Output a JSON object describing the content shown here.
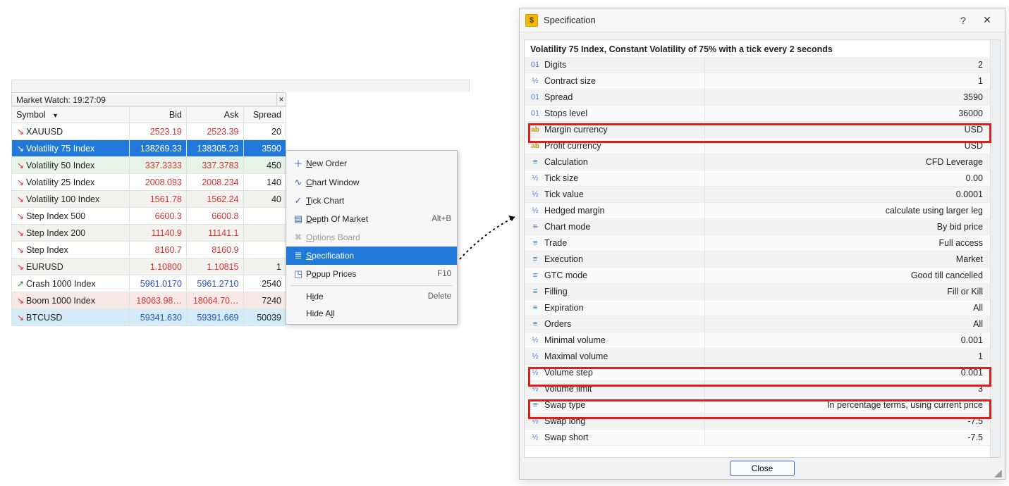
{
  "market_watch": {
    "title": "Market Watch: 19:27:09",
    "headers": {
      "symbol": "Symbol",
      "bid": "Bid",
      "ask": "Ask",
      "spread": "Spread"
    },
    "rows": [
      {
        "symbol": "XAUUSD",
        "bid": "2523.19",
        "ask": "2523.39",
        "spread": "20",
        "dir": "down",
        "selected": false,
        "rowStyle": "",
        "priceClass": "red"
      },
      {
        "symbol": "Volatility 75 Index",
        "bid": "138269.33",
        "ask": "138305.23",
        "spread": "3590",
        "dir": "down",
        "selected": true,
        "rowStyle": "",
        "priceClass": ""
      },
      {
        "symbol": "Volatility 50 Index",
        "bid": "337.3333",
        "ask": "337.3783",
        "spread": "450",
        "dir": "down",
        "selected": false,
        "rowStyle": "alt-green",
        "priceClass": "red"
      },
      {
        "symbol": "Volatility 25 Index",
        "bid": "2008.093",
        "ask": "2008.234",
        "spread": "140",
        "dir": "down",
        "selected": false,
        "rowStyle": "",
        "priceClass": "red"
      },
      {
        "symbol": "Volatility 100 Index",
        "bid": "1561.78",
        "ask": "1562.24",
        "spread": "40",
        "dir": "down",
        "selected": false,
        "rowStyle": "alt",
        "priceClass": "red"
      },
      {
        "symbol": "Step Index 500",
        "bid": "6600.3",
        "ask": "6600.8",
        "spread": "",
        "dir": "down",
        "selected": false,
        "rowStyle": "",
        "priceClass": "red"
      },
      {
        "symbol": "Step Index 200",
        "bid": "11140.9",
        "ask": "11141.1",
        "spread": "",
        "dir": "down",
        "selected": false,
        "rowStyle": "alt",
        "priceClass": "red"
      },
      {
        "symbol": "Step Index",
        "bid": "8160.7",
        "ask": "8160.9",
        "spread": "",
        "dir": "down",
        "selected": false,
        "rowStyle": "",
        "priceClass": "red"
      },
      {
        "symbol": "EURUSD",
        "bid": "1.10800",
        "ask": "1.10815",
        "spread": "1",
        "dir": "down",
        "selected": false,
        "rowStyle": "alt",
        "priceClass": "red"
      },
      {
        "symbol": "Crash 1000 Index",
        "bid": "5961.0170",
        "ask": "5961.2710",
        "spread": "2540",
        "dir": "up",
        "selected": false,
        "rowStyle": "",
        "priceClass": "blue"
      },
      {
        "symbol": "Boom 1000 Index",
        "bid": "18063.98…",
        "ask": "18064.70…",
        "spread": "7240",
        "dir": "down",
        "selected": false,
        "rowStyle": "alt-pink",
        "priceClass": "red"
      },
      {
        "symbol": "BTCUSD",
        "bid": "59341.630",
        "ask": "59391.669",
        "spread": "50039",
        "dir": "down",
        "selected": false,
        "rowStyle": "alt-blue",
        "priceClass": "blue"
      }
    ]
  },
  "context_menu": {
    "items": [
      {
        "icon": "＋",
        "label_pre": "",
        "label_u": "N",
        "label_post": "ew Order",
        "shortcut": "",
        "state": ""
      },
      {
        "icon": "∿",
        "label_pre": "",
        "label_u": "C",
        "label_post": "hart Window",
        "shortcut": "",
        "state": ""
      },
      {
        "icon": "✓",
        "label_pre": "",
        "label_u": "T",
        "label_post": "ick Chart",
        "shortcut": "",
        "state": ""
      },
      {
        "icon": "▤",
        "label_pre": "",
        "label_u": "D",
        "label_post": "epth Of Market",
        "shortcut": "Alt+B",
        "state": ""
      },
      {
        "icon": "✖",
        "label_pre": "",
        "label_u": "O",
        "label_post": "ptions Board",
        "shortcut": "",
        "state": "disabled"
      },
      {
        "icon": "≣",
        "label_pre": "",
        "label_u": "S",
        "label_post": "pecification",
        "shortcut": "",
        "state": "sel"
      },
      {
        "icon": "◳",
        "label_pre": "P",
        "label_u": "o",
        "label_post": "pup Prices",
        "shortcut": "F10",
        "state": ""
      },
      {
        "sep": true
      },
      {
        "icon": "",
        "label_pre": "H",
        "label_u": "i",
        "label_post": "de",
        "shortcut": "Delete",
        "state": ""
      },
      {
        "icon": "",
        "label_pre": "Hide A",
        "label_u": "l",
        "label_post": "l",
        "shortcut": "",
        "state": ""
      }
    ]
  },
  "spec": {
    "title": "Specification",
    "header": "Volatility 75 Index, Constant Volatility of 75% with a tick every 2 seconds",
    "close_btn": "Close",
    "rows": [
      {
        "ico": "01",
        "icoClass": "",
        "key": "Digits",
        "val": "2"
      },
      {
        "ico": "½",
        "icoClass": "half",
        "key": "Contract size",
        "val": "1"
      },
      {
        "ico": "01",
        "icoClass": "",
        "key": "Spread",
        "val": "3590"
      },
      {
        "ico": "01",
        "icoClass": "",
        "key": "Stops level",
        "val": "36000"
      },
      {
        "ico": "ab",
        "icoClass": "ab",
        "key": "Margin currency",
        "val": "USD"
      },
      {
        "ico": "ab",
        "icoClass": "ab",
        "key": "Profit currency",
        "val": "USD"
      },
      {
        "ico": "≡",
        "icoClass": "lines",
        "key": "Calculation",
        "val": "CFD Leverage"
      },
      {
        "ico": "½",
        "icoClass": "half",
        "key": "Tick size",
        "val": "0.00"
      },
      {
        "ico": "½",
        "icoClass": "half",
        "key": "Tick value",
        "val": "0.0001"
      },
      {
        "ico": "½",
        "icoClass": "half",
        "key": "Hedged margin",
        "val": "calculate using larger leg"
      },
      {
        "ico": "≡",
        "icoClass": "lines",
        "key": "Chart mode",
        "val": "By bid price"
      },
      {
        "ico": "≡",
        "icoClass": "lines",
        "key": "Trade",
        "val": "Full access"
      },
      {
        "ico": "≡",
        "icoClass": "lines",
        "key": "Execution",
        "val": "Market"
      },
      {
        "ico": "≡",
        "icoClass": "lines",
        "key": "GTC mode",
        "val": "Good till cancelled"
      },
      {
        "ico": "≡",
        "icoClass": "lines",
        "key": "Filling",
        "val": "Fill or Kill"
      },
      {
        "ico": "≡",
        "icoClass": "lines",
        "key": "Expiration",
        "val": "All"
      },
      {
        "ico": "≡",
        "icoClass": "lines",
        "key": "Orders",
        "val": "All"
      },
      {
        "ico": "½",
        "icoClass": "half",
        "key": "Minimal volume",
        "val": "0.001"
      },
      {
        "ico": "½",
        "icoClass": "half",
        "key": "Maximal volume",
        "val": "1"
      },
      {
        "ico": "½",
        "icoClass": "half",
        "key": "Volume step",
        "val": "0.001"
      },
      {
        "ico": "½",
        "icoClass": "half",
        "key": "Volume limit",
        "val": "3"
      },
      {
        "ico": "≡",
        "icoClass": "lines",
        "key": "Swap type",
        "val": "In percentage terms, using current price"
      },
      {
        "ico": "½",
        "icoClass": "half",
        "key": "Swap long",
        "val": "-7.5"
      },
      {
        "ico": "½",
        "icoClass": "half",
        "key": "Swap short",
        "val": "-7.5"
      }
    ]
  }
}
